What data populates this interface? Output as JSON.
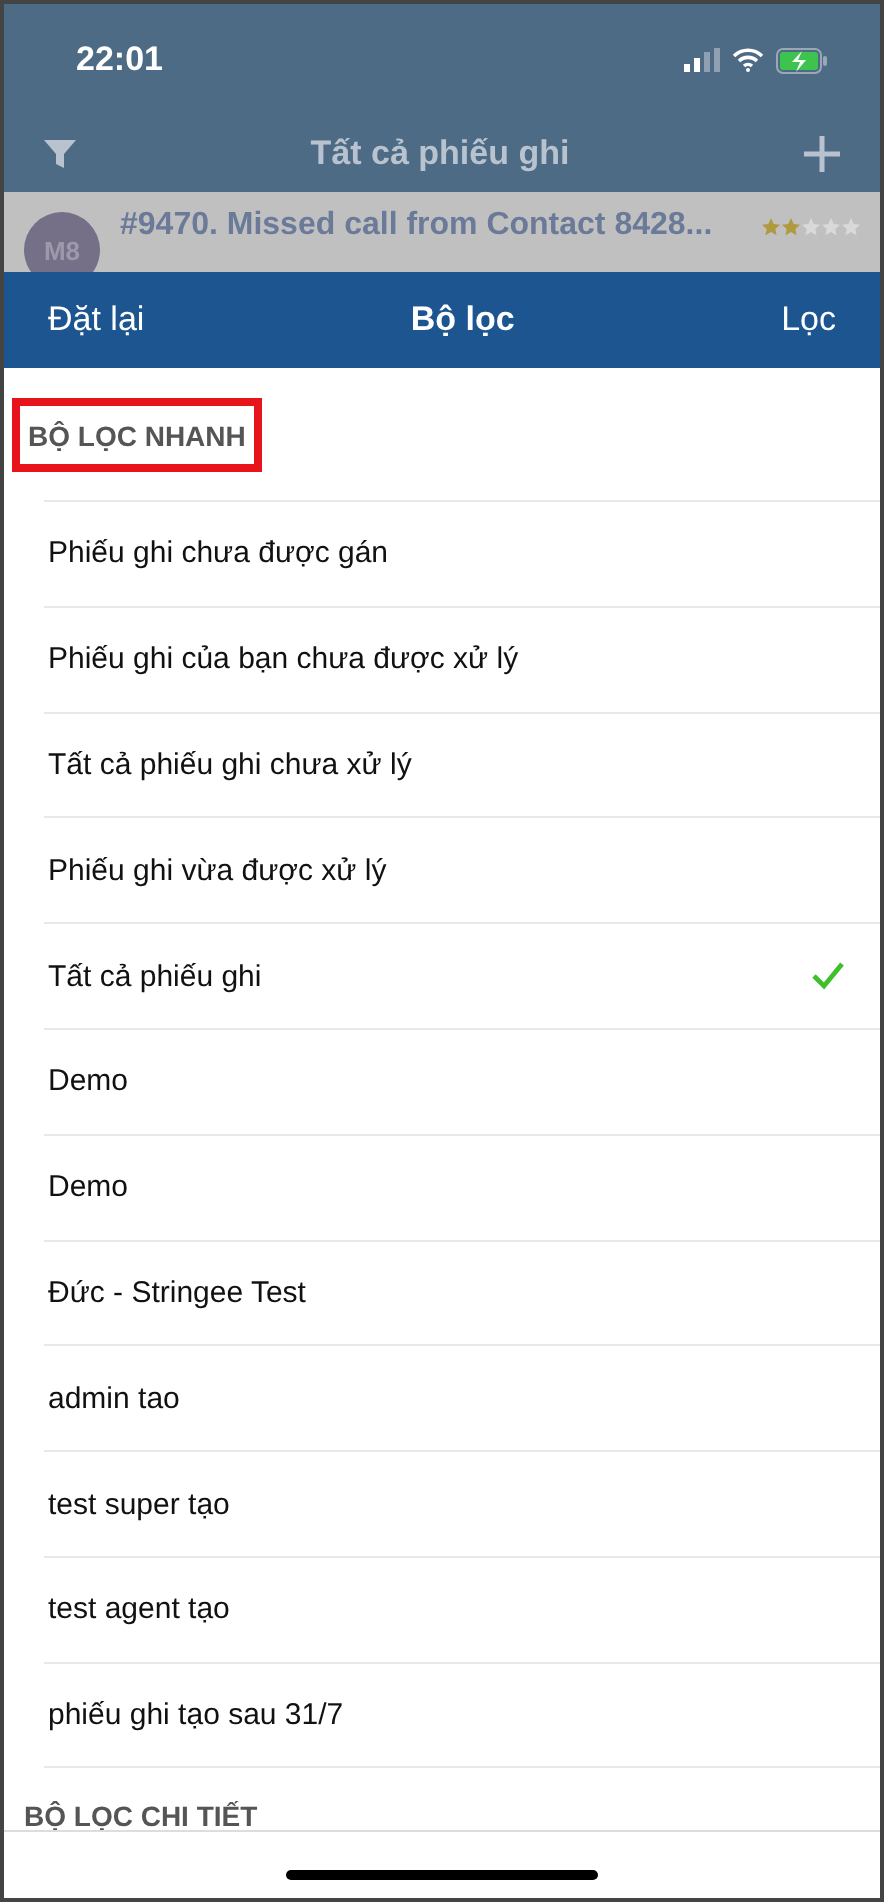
{
  "status_bar": {
    "time": "22:01"
  },
  "nav": {
    "title": "Tất cả phiếu ghi"
  },
  "ticket": {
    "avatar": "M8",
    "title": "#9470. Missed call from Contact 8428...",
    "stars": 2
  },
  "sheet": {
    "reset": "Đặt lại",
    "title": "Bộ lọc",
    "apply": "Lọc"
  },
  "quick_section": {
    "title": "BỘ LỌC NHANH",
    "highlighted": true
  },
  "filters": [
    {
      "label": "Phiếu ghi chưa được gán",
      "selected": false
    },
    {
      "label": "Phiếu ghi của bạn chưa được xử lý",
      "selected": false
    },
    {
      "label": "Tất cả phiếu ghi chưa xử lý",
      "selected": false
    },
    {
      "label": "Phiếu ghi vừa được xử lý",
      "selected": false
    },
    {
      "label": "Tất cả phiếu ghi",
      "selected": true
    },
    {
      "label": "Demo",
      "selected": false
    },
    {
      "label": "Demo",
      "selected": false
    },
    {
      "label": "Đức - Stringee Test",
      "selected": false
    },
    {
      "label": "admin tao",
      "selected": false
    },
    {
      "label": "test super tạo",
      "selected": false
    },
    {
      "label": "test agent tạo",
      "selected": false
    },
    {
      "label": "phiếu ghi tạo sau 31/7",
      "selected": false
    }
  ],
  "detail_section": {
    "title": "BỘ LỌC CHI TIẾT"
  }
}
